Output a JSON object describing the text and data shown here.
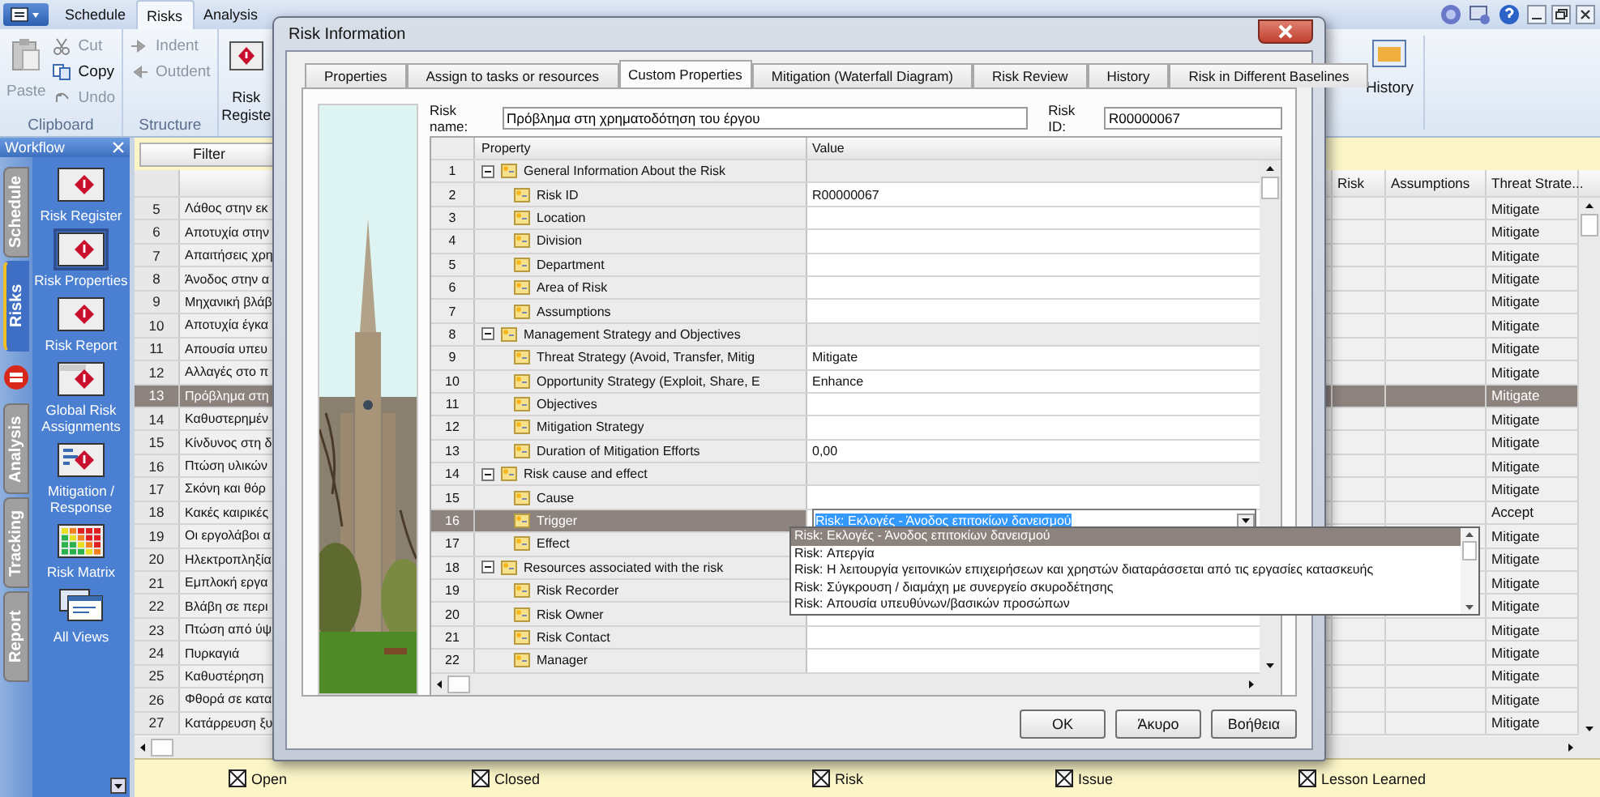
{
  "app_tabs": [
    {
      "label": "Schedule",
      "selected": false
    },
    {
      "label": "Risks",
      "selected": true
    },
    {
      "label": "Analysis",
      "selected": false
    }
  ],
  "ribbon": {
    "paste": {
      "label": "Paste",
      "disabled": true
    },
    "clipboard_items": [
      {
        "label": "Cut",
        "disabled": true
      },
      {
        "label": "Copy",
        "disabled": false
      },
      {
        "label": "Undo",
        "disabled": true
      }
    ],
    "clipboard_label": "Clipboard",
    "structure_items": [
      {
        "label": "Indent",
        "disabled": true
      },
      {
        "label": "Outdent",
        "disabled": true
      }
    ],
    "structure_label": "Structure",
    "risk_register": "Risk Registe",
    "history": "History"
  },
  "workflow": {
    "title": "Workflow",
    "tabs": [
      {
        "label": "Schedule",
        "selected": false
      },
      {
        "label": "Risks",
        "selected": true
      },
      {
        "label": "Analysis",
        "selected": false
      },
      {
        "label": "Tracking",
        "selected": false
      },
      {
        "label": "Report",
        "selected": false
      }
    ],
    "items": [
      {
        "label": "Risk Register",
        "selected": false
      },
      {
        "label": "Risk Properties",
        "selected": true
      },
      {
        "label": "Risk Report",
        "selected": false
      },
      {
        "label": "Global Risk Assignments",
        "selected": false
      },
      {
        "label": "Mitigation / Response",
        "selected": false
      },
      {
        "label": "Risk Matrix",
        "selected": false
      },
      {
        "label": "All Views",
        "selected": false
      }
    ]
  },
  "grid": {
    "filter": "Filter",
    "columns": [
      "Risk",
      "Assumptions",
      "Threat Strate..."
    ],
    "rows": [
      {
        "num": "5",
        "name": "Λάθος στην εκ",
        "threat": "Mitigate",
        "selected": false
      },
      {
        "num": "6",
        "name": "Αποτυχία στην",
        "threat": "Mitigate",
        "selected": false
      },
      {
        "num": "7",
        "name": "Απαιτήσεις χρη",
        "threat": "Mitigate",
        "selected": false
      },
      {
        "num": "8",
        "name": "Άνοδος στην α",
        "threat": "Mitigate",
        "selected": false
      },
      {
        "num": "9",
        "name": "Μηχανική βλάβ",
        "threat": "Mitigate",
        "selected": false
      },
      {
        "num": "10",
        "name": "Αποτυχία έγκα",
        "threat": "Mitigate",
        "selected": false
      },
      {
        "num": "11",
        "name": "Απουσία υπευ",
        "threat": "Mitigate",
        "selected": false
      },
      {
        "num": "12",
        "name": "Αλλαγές στο π",
        "threat": "Mitigate",
        "selected": false
      },
      {
        "num": "13",
        "name": "Πρόβλημα στη",
        "threat": "Mitigate",
        "selected": true
      },
      {
        "num": "14",
        "name": "Καθυστερημέν",
        "threat": "Mitigate",
        "selected": false
      },
      {
        "num": "15",
        "name": "Κίνδυνος στη δ",
        "threat": "Mitigate",
        "selected": false
      },
      {
        "num": "16",
        "name": "Πτώση υλικών",
        "threat": "Mitigate",
        "selected": false
      },
      {
        "num": "17",
        "name": "Σκόνη και θόρ",
        "threat": "Mitigate",
        "selected": false
      },
      {
        "num": "18",
        "name": "Κακές καιρικές",
        "threat": "Accept",
        "selected": false
      },
      {
        "num": "19",
        "name": "Οι εργολάβοι α",
        "threat": "Mitigate",
        "selected": false
      },
      {
        "num": "20",
        "name": "Ηλεκτροπληξία",
        "threat": "Mitigate",
        "selected": false
      },
      {
        "num": "21",
        "name": "Εμπλοκή εργα",
        "threat": "Mitigate",
        "selected": false
      },
      {
        "num": "22",
        "name": "Βλάβη σε περι",
        "threat": "Mitigate",
        "selected": false
      },
      {
        "num": "23",
        "name": "Πτώση από ύψ",
        "threat": "Mitigate",
        "selected": false
      },
      {
        "num": "24",
        "name": "Πυρκαγιά",
        "threat": "Mitigate",
        "selected": false
      },
      {
        "num": "25",
        "name": "Καθυστέρηση",
        "threat": "Mitigate",
        "selected": false
      },
      {
        "num": "26",
        "name": "Φθορά σε κατα",
        "threat": "Mitigate",
        "selected": false
      },
      {
        "num": "27",
        "name": "Κατάρρευση ξυ",
        "threat": "Mitigate",
        "selected": false
      }
    ]
  },
  "legend": [
    "Open",
    "Closed",
    "Risk",
    "Issue",
    "Lesson Learned"
  ],
  "dialog": {
    "title": "Risk Information",
    "tabs": [
      {
        "label": "Properties",
        "selected": false
      },
      {
        "label": "Assign to tasks or resources",
        "selected": false
      },
      {
        "label": "Custom Properties",
        "selected": true
      },
      {
        "label": "Mitigation (Waterfall Diagram)",
        "selected": false
      },
      {
        "label": "Risk Review",
        "selected": false
      },
      {
        "label": "History",
        "selected": false
      },
      {
        "label": "Risk in Different Baselines",
        "selected": false
      }
    ],
    "risk_name_label": "Risk name:",
    "risk_name": "Πρόβλημα στη χρηματοδότηση του έργου",
    "risk_id_label": "Risk ID:",
    "risk_id": "R00000067",
    "columns": [
      "Property",
      "Value"
    ],
    "rows": [
      {
        "num": "1",
        "kind": "group",
        "expanded": true,
        "label": "General Information About the Risk",
        "selected": false
      },
      {
        "num": "2",
        "kind": "property",
        "label": "Risk ID",
        "value": "R00000067",
        "selected": false
      },
      {
        "num": "3",
        "kind": "property",
        "label": "Location",
        "selected": false
      },
      {
        "num": "4",
        "kind": "property",
        "label": "Division",
        "selected": false
      },
      {
        "num": "5",
        "kind": "property",
        "label": "Department",
        "selected": false
      },
      {
        "num": "6",
        "kind": "property",
        "label": "Area of Risk",
        "selected": false
      },
      {
        "num": "7",
        "kind": "property",
        "label": "Assumptions",
        "selected": false
      },
      {
        "num": "8",
        "kind": "group",
        "expanded": true,
        "label": "Management Strategy and Objectives",
        "selected": false
      },
      {
        "num": "9",
        "kind": "property",
        "label": "Threat Strategy (Avoid, Transfer, Mitig",
        "value": "Mitigate",
        "selected": false
      },
      {
        "num": "10",
        "kind": "property",
        "label": "Opportunity Strategy (Exploit, Share, E",
        "value": "Enhance",
        "selected": false
      },
      {
        "num": "11",
        "kind": "property",
        "label": "Objectives",
        "selected": false
      },
      {
        "num": "12",
        "kind": "property",
        "label": "Mitigation Strategy",
        "selected": false
      },
      {
        "num": "13",
        "kind": "property",
        "label": "Duration of Mitigation Efforts",
        "value": "0,00",
        "selected": false
      },
      {
        "num": "14",
        "kind": "group",
        "expanded": true,
        "label": "Risk cause and effect",
        "selected": false
      },
      {
        "num": "15",
        "kind": "property",
        "label": "Cause",
        "selected": false
      },
      {
        "num": "16",
        "kind": "property",
        "label": "Trigger",
        "value": "Risk: Εκλογές - Άνοδος επιτοκίων δανεισμού",
        "selected": true
      },
      {
        "num": "17",
        "kind": "property",
        "label": "Effect",
        "selected": false
      },
      {
        "num": "18",
        "kind": "group",
        "expanded": true,
        "label": "Resources associated with the risk",
        "selected": false
      },
      {
        "num": "19",
        "kind": "property",
        "label": "Risk Recorder",
        "selected": false
      },
      {
        "num": "20",
        "kind": "property",
        "label": "Risk Owner",
        "selected": false
      },
      {
        "num": "21",
        "kind": "property",
        "label": "Risk Contact",
        "selected": false
      },
      {
        "num": "22",
        "kind": "property",
        "label": "Manager",
        "selected": false
      }
    ],
    "dropdown": [
      {
        "label": "Risk: Εκλογές - Άνοδος επιτοκίων δανεισμού",
        "selected": true
      },
      {
        "label": "Risk: Απεργία",
        "selected": false
      },
      {
        "label": "Risk: Η λειτουργία γειτονικών επιχειρήσεων και χρηστών διαταράσσεται από τις εργασίες κατασκευής",
        "selected": false
      },
      {
        "label": "Risk: Σύγκρουση / διαμάχη με συνεργείο σκυροδέτησης",
        "selected": false
      },
      {
        "label": "Risk: Απουσία υπευθύνων/βασικών προσώπων",
        "selected": false
      }
    ],
    "buttons": [
      "OK",
      "Άκυρο",
      "Βοήθεια"
    ]
  }
}
